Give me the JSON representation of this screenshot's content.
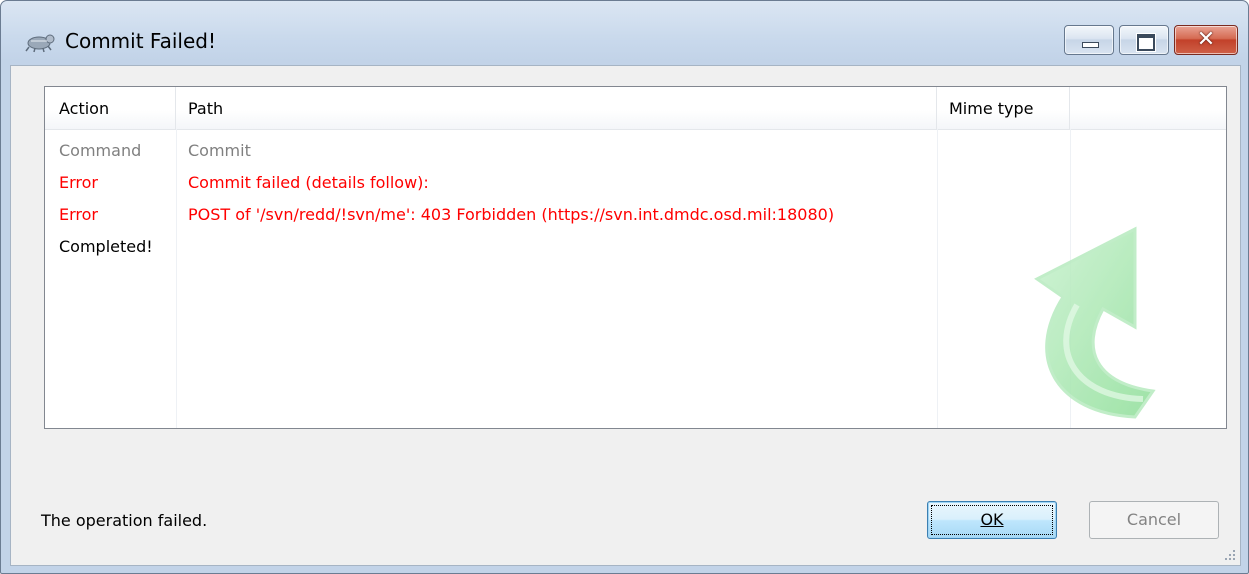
{
  "window": {
    "title": "Commit Failed!",
    "icon": "tortoisesvn-icon"
  },
  "list": {
    "columns": [
      "Action",
      "Path",
      "Mime type",
      ""
    ],
    "rows": [
      {
        "action": "Command",
        "path": "Commit",
        "color": "#808080"
      },
      {
        "action": "Error",
        "path": "Commit failed (details follow):",
        "color": "#ff0000"
      },
      {
        "action": "Error",
        "path": "POST of '/svn/redd/!svn/me': 403 Forbidden (https://svn.int.dmdc.osd.mil:18080)",
        "color": "#ff0000"
      },
      {
        "action": "Completed!",
        "path": "",
        "color": "#000000"
      }
    ]
  },
  "status": "The operation failed.",
  "buttons": {
    "ok": "OK",
    "cancel": "Cancel"
  },
  "colors": {
    "error": "#ff0000",
    "muted": "#808080",
    "watermark": "#7fd88a"
  }
}
